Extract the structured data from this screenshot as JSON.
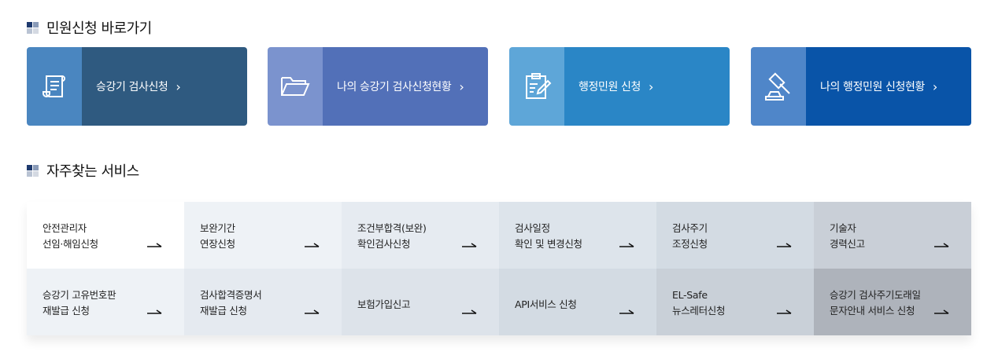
{
  "sections": {
    "apply_title": "민원신청 바로가기",
    "service_title": "자주찾는 서비스"
  },
  "quick_links": [
    {
      "label": "승강기 검사신청",
      "icon": "scroll-document-icon"
    },
    {
      "label": "나의 승강기 검사신청현황",
      "icon": "folder-icon"
    },
    {
      "label": "행정민원 신청",
      "icon": "clipboard-edit-icon"
    },
    {
      "label": "나의 행정민원 신청현황",
      "icon": "gavel-icon"
    }
  ],
  "chevron": "›",
  "services": [
    {
      "label": "안전관리자\n선임·해임신청"
    },
    {
      "label": "보완기간\n연장신청"
    },
    {
      "label": "조건부합격(보완)\n확인검사신청"
    },
    {
      "label": "검사일정\n확인 및 변경신청"
    },
    {
      "label": "검사주기\n조정신청"
    },
    {
      "label": "기술자\n경력신고"
    },
    {
      "label": "승강기 고유번호판\n재발급 신청"
    },
    {
      "label": "검사합격증명서\n재발급 신청"
    },
    {
      "label": "보험가입신고"
    },
    {
      "label": "API서비스 신청"
    },
    {
      "label": "EL-Safe\n뉴스레터신청"
    },
    {
      "label": "승강기 검사주기도래일\n문자안내 서비스 신청"
    }
  ]
}
